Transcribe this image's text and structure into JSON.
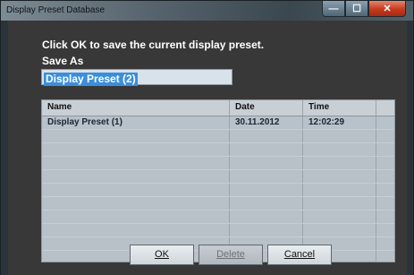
{
  "window": {
    "title": "Display Preset Database",
    "controls": {
      "minimize": "—",
      "maximize": "☐",
      "close": "✕"
    }
  },
  "dialog": {
    "message": "Click OK to save the current display preset.",
    "save_as_label": "Save As",
    "save_as_value": "Display Preset (2)"
  },
  "table": {
    "headers": [
      "Name",
      "Date",
      "Time"
    ],
    "rows": [
      {
        "name": "Display Preset (1)",
        "date": "30.11.2012",
        "time": "12:02:29"
      }
    ]
  },
  "buttons": {
    "ok": "OK",
    "delete": "Delete",
    "cancel": "Cancel"
  }
}
